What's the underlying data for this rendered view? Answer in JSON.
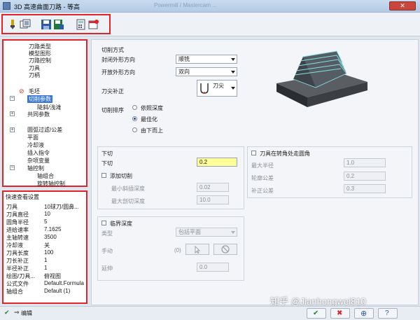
{
  "window": {
    "title": "3D 高速曲面刀路 - 等高",
    "ghost_title": "Powermill / Mastercam ...",
    "close_glyph": "✕"
  },
  "toolbar": {
    "icons": [
      "tool-icon",
      "options-icon",
      "save-icon",
      "export-icon",
      "calculator-icon",
      "settings-icon"
    ]
  },
  "tree": {
    "items": [
      {
        "label": "刀路类型"
      },
      {
        "label": "模型图形"
      },
      {
        "label": "刀路控制"
      },
      {
        "label": "刀具"
      },
      {
        "label": "刀柄"
      },
      {
        "label": "毛坯"
      },
      {
        "label": "切削参数"
      },
      {
        "label": "陡斜/浅滩"
      },
      {
        "label": "共同参数"
      },
      {
        "label": "圆弧过滤/公差"
      },
      {
        "label": "平面"
      },
      {
        "label": "冷却液"
      },
      {
        "label": "插入指令"
      },
      {
        "label": "杂项变量"
      },
      {
        "label": "轴控制"
      },
      {
        "label": "轴组合"
      },
      {
        "label": "旋转轴控制"
      }
    ]
  },
  "quick_view": {
    "title": "快速查看设置",
    "rows": [
      {
        "k": "刀具",
        "v": "10球刀/圆鼻..."
      },
      {
        "k": "刀具直径",
        "v": "10"
      },
      {
        "k": "圆角半径",
        "v": "5"
      },
      {
        "k": "进给速率",
        "v": "7.1625"
      },
      {
        "k": "主轴转速",
        "v": "3500"
      },
      {
        "k": "冷却液",
        "v": "关"
      },
      {
        "k": "刀具长度",
        "v": "100"
      },
      {
        "k": "刀长补正",
        "v": "1"
      },
      {
        "k": "半径补正",
        "v": "1"
      },
      {
        "k": "绘图/刀具...",
        "v": "俯视图"
      },
      {
        "k": "公式文件",
        "v": "Default.Formula"
      },
      {
        "k": "轴组合",
        "v": "Default (1)"
      }
    ]
  },
  "cut_style": {
    "section_label": "切削方式",
    "closed_label": "封闭外形方向",
    "closed_value": "顺铣",
    "open_label": "开放外形方向",
    "open_value": "双向",
    "tip_comp_label": "刀尖补正",
    "tip_comp_value": "刀尖",
    "order_label": "切削排序",
    "order_options": [
      "依照深度",
      "最佳化",
      "由下而上"
    ],
    "order_selected": "最佳化"
  },
  "step_down": {
    "section_label": "下切",
    "label": "下切",
    "value": "0.2",
    "add_cut_label": "添加切削",
    "min_slope_label": "最小斜插深度",
    "min_slope_value": "0.02",
    "max_cut_label": "最大剖切深度",
    "max_cut_value": "10.0"
  },
  "corner": {
    "label": "刀具在转角处走圆角",
    "max_radius_label": "最大半径",
    "max_radius_value": "1.0",
    "profile_tol_label": "轮廓公差",
    "profile_tol_value": "0.2",
    "offset_tol_label": "补正公差",
    "offset_tol_value": "0.3"
  },
  "critical": {
    "label": "临界深度",
    "type_label": "类型",
    "type_value": "包括平面",
    "manual_label": "手动",
    "manual_count": "(0)",
    "extend_label": "延伸",
    "extend_value": "0.0"
  },
  "status": {
    "edit_label": "编辑"
  },
  "watermark": "知乎 @Jianhongwei810",
  "colors": {
    "highlight": "#e0242a",
    "selection": "#3b78d4",
    "yellow_field": "#ffff9a"
  }
}
